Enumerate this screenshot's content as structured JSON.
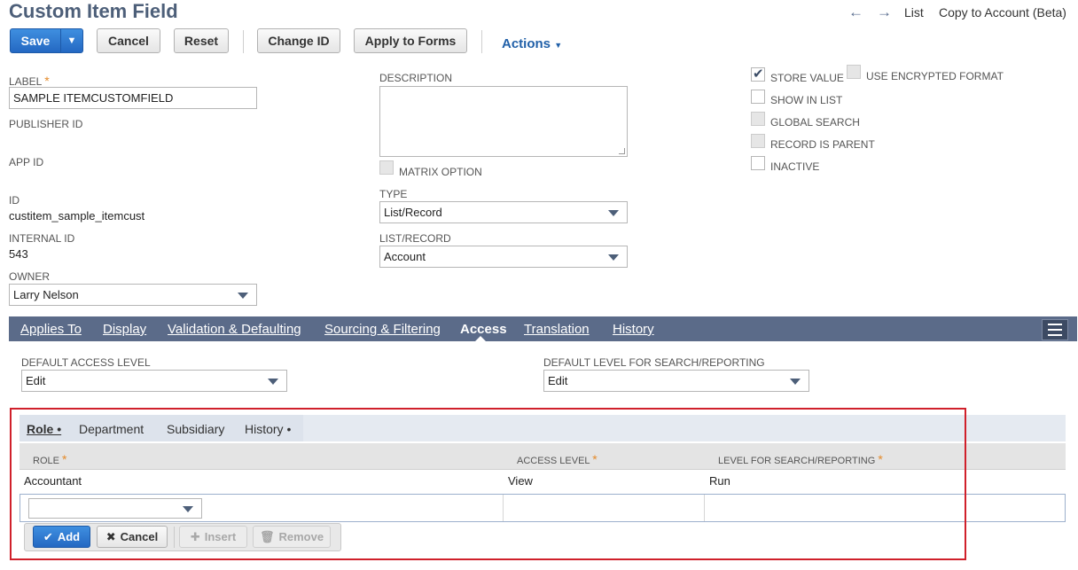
{
  "header": {
    "title": "Custom Item Field",
    "nav": {
      "list": "List",
      "copy": "Copy to Account (Beta)"
    }
  },
  "toolbar": {
    "save": "Save",
    "cancel": "Cancel",
    "reset": "Reset",
    "change_id": "Change ID",
    "apply_to_forms": "Apply to Forms",
    "actions": "Actions"
  },
  "form": {
    "label": {
      "label": "LABEL",
      "value": "SAMPLE ITEMCUSTOMFIELD"
    },
    "publisher_id": {
      "label": "PUBLISHER ID"
    },
    "app_id": {
      "label": "APP ID"
    },
    "id": {
      "label": "ID",
      "value": "custitem_sample_itemcust"
    },
    "internal_id": {
      "label": "INTERNAL ID",
      "value": "543"
    },
    "owner": {
      "label": "OWNER",
      "value": "Larry Nelson"
    },
    "description": {
      "label": "DESCRIPTION",
      "value": ""
    },
    "matrix_option": {
      "label": "MATRIX OPTION"
    },
    "type": {
      "label": "TYPE",
      "value": "List/Record"
    },
    "list_record": {
      "label": "LIST/RECORD",
      "value": "Account"
    },
    "store_value": {
      "label": "STORE VALUE",
      "checked": true
    },
    "use_encrypted": {
      "label": "USE ENCRYPTED FORMAT"
    },
    "show_in_list": {
      "label": "SHOW IN LIST"
    },
    "global_search": {
      "label": "GLOBAL SEARCH"
    },
    "record_is_parent": {
      "label": "RECORD IS PARENT"
    },
    "inactive": {
      "label": "INACTIVE"
    }
  },
  "tabs": [
    {
      "label": "Applies To"
    },
    {
      "label": "Display"
    },
    {
      "label": "Validation & Defaulting"
    },
    {
      "label": "Sourcing & Filtering"
    },
    {
      "label": "Access"
    },
    {
      "label": "Translation"
    },
    {
      "label": "History"
    }
  ],
  "access": {
    "default_access_level": {
      "label": "DEFAULT ACCESS LEVEL",
      "value": "Edit"
    },
    "default_search_level": {
      "label": "DEFAULT LEVEL FOR SEARCH/REPORTING",
      "value": "Edit"
    }
  },
  "subtabs": [
    {
      "label": "Role •"
    },
    {
      "label": "Department"
    },
    {
      "label": "Subsidiary"
    },
    {
      "label": "History •"
    }
  ],
  "grid": {
    "columns": [
      "ROLE",
      "ACCESS LEVEL",
      "LEVEL FOR SEARCH/REPORTING"
    ],
    "rows": [
      {
        "role": "Accountant",
        "access": "View",
        "search": "Run"
      }
    ]
  },
  "row_buttons": {
    "add": "Add",
    "cancel": "Cancel",
    "insert": "Insert",
    "remove": "Remove"
  },
  "colors": {
    "accent": "#2468c2",
    "tabbar": "#5b6b89",
    "title": "#4d5f79",
    "highlight": "#d0202b"
  }
}
